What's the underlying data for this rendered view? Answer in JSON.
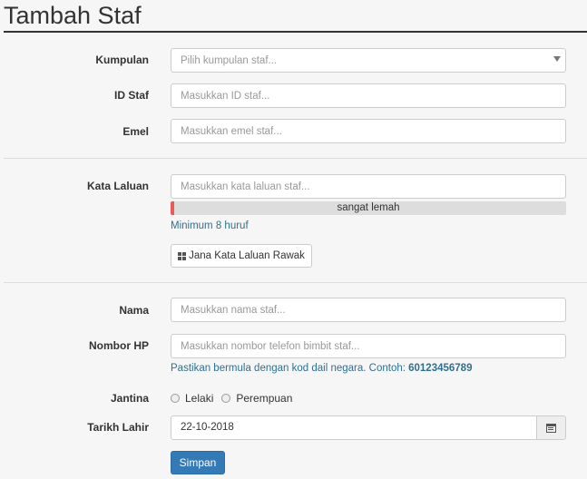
{
  "page": {
    "title": "Tambah Staf"
  },
  "form": {
    "group": {
      "label": "Kumpulan",
      "placeholder": "Pilih kumpulan staf..."
    },
    "staff_id": {
      "label": "ID Staf",
      "placeholder": "Masukkan ID staf..."
    },
    "email": {
      "label": "Emel",
      "placeholder": "Masukkan emel staf..."
    },
    "password": {
      "label": "Kata Laluan",
      "placeholder": "Masukkan kata laluan staf...",
      "strength_text": "sangat lemah",
      "strength_fraction": 0.01,
      "strength_color": "#e85b5b",
      "hint": "Minimum 8 huruf",
      "generate_label": "Jana Kata Laluan Rawak",
      "generate_icon": "grid-icon"
    },
    "name": {
      "label": "Nama",
      "placeholder": "Masukkan nama staf..."
    },
    "phone": {
      "label": "Nombor HP",
      "placeholder": "Masukkan nombor telefon bimbit staf...",
      "hint_prefix": "Pastikan bermula dengan kod dail negara. Contoh: ",
      "hint_example": "60123456789"
    },
    "gender": {
      "label": "Jantina",
      "options": [
        "Lelaki",
        "Perempuan"
      ]
    },
    "birthdate": {
      "label": "Tarikh Lahir",
      "value": "22-10-2018",
      "icon": "calendar-icon"
    },
    "submit_label": "Simpan"
  },
  "colors": {
    "primary": "#337ab7",
    "help_text": "#31708f"
  }
}
